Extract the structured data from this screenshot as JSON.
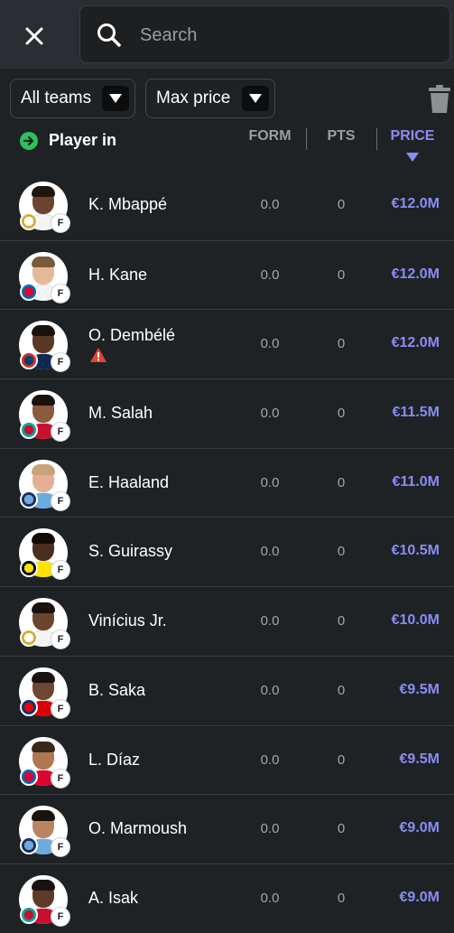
{
  "search": {
    "placeholder": "Search",
    "value": ""
  },
  "filters": {
    "teams_label": "All teams",
    "price_label": "Max price"
  },
  "header": {
    "player_in": "Player in",
    "columns": {
      "form": "FORM",
      "pts": "PTS",
      "price": "PRICE"
    },
    "sort_column": "PRICE",
    "sort_direction": "descending"
  },
  "colors": {
    "accent": "#8a8cf5",
    "background": "#1f2224",
    "topbar": "#2a2d31",
    "go_green": "#2fbf5f",
    "warning": "#e0483c"
  },
  "players": [
    {
      "name": "K. Mbappé",
      "form": "0.0",
      "pts": "0",
      "price": "€12.0M",
      "position": "F",
      "club": "real-madrid",
      "warning": false
    },
    {
      "name": "H. Kane",
      "form": "0.0",
      "pts": "0",
      "price": "€12.0M",
      "position": "F",
      "club": "bayern",
      "warning": false
    },
    {
      "name": "O. Dembélé",
      "form": "0.0",
      "pts": "0",
      "price": "€12.0M",
      "position": "F",
      "club": "psg",
      "warning": true
    },
    {
      "name": "M. Salah",
      "form": "0.0",
      "pts": "0",
      "price": "€11.5M",
      "position": "F",
      "club": "liverpool",
      "warning": false
    },
    {
      "name": "E. Haaland",
      "form": "0.0",
      "pts": "0",
      "price": "€11.0M",
      "position": "F",
      "club": "man-city",
      "warning": false
    },
    {
      "name": "S. Guirassy",
      "form": "0.0",
      "pts": "0",
      "price": "€10.5M",
      "position": "F",
      "club": "dortmund",
      "warning": false
    },
    {
      "name": "Vinícius Jr.",
      "form": "0.0",
      "pts": "0",
      "price": "€10.0M",
      "position": "F",
      "club": "real-madrid",
      "warning": false
    },
    {
      "name": "B. Saka",
      "form": "0.0",
      "pts": "0",
      "price": "€9.5M",
      "position": "F",
      "club": "arsenal",
      "warning": false
    },
    {
      "name": "L. Díaz",
      "form": "0.0",
      "pts": "0",
      "price": "€9.5M",
      "position": "F",
      "club": "bayern",
      "warning": false
    },
    {
      "name": "O. Marmoush",
      "form": "0.0",
      "pts": "0",
      "price": "€9.0M",
      "position": "F",
      "club": "man-city",
      "warning": false
    },
    {
      "name": "A. Isak",
      "form": "0.0",
      "pts": "0",
      "price": "€9.0M",
      "position": "F",
      "club": "liverpool",
      "warning": false
    }
  ]
}
